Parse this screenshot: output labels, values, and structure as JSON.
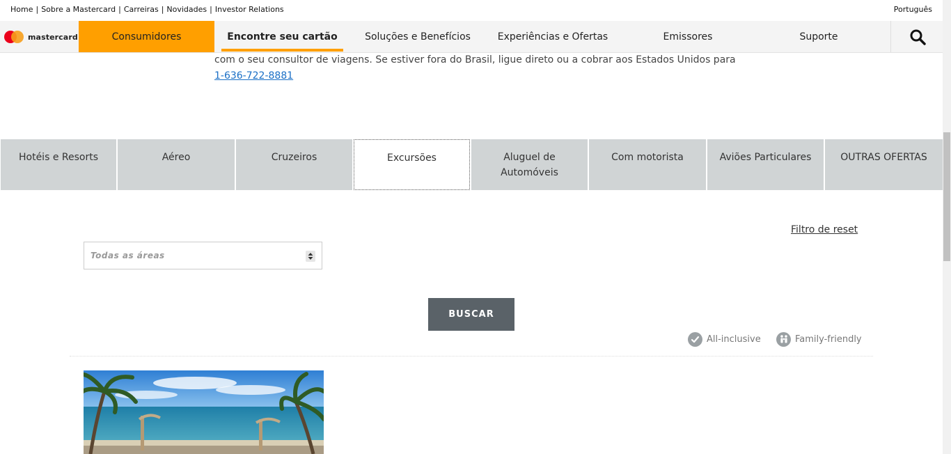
{
  "utility": {
    "links": [
      "Home",
      "Sobre a Mastercard",
      "Carreiras",
      "Novidades",
      "Investor Relations"
    ],
    "language": "Português"
  },
  "brand": {
    "name": "mastercard",
    "colors": {
      "red": "#eb001b",
      "orange": "#f79e1b",
      "accent": "#ff9f00"
    }
  },
  "nav": {
    "items": [
      "Consumidores",
      "Encontre seu cartão",
      "Soluções e Benefícios",
      "Experiências e Ofertas",
      "Emissores",
      "Suporte"
    ],
    "search_icon": "search-icon"
  },
  "intro": {
    "text": "com o seu consultor de viagens. Se estiver fora do Brasil, ligue direto ou a cobrar aos Estados Unidos para",
    "phone": "1-636-722-8881"
  },
  "tabs": [
    "Hotéis e Resorts",
    "Aéreo",
    "Cruzeiros",
    "Excursões",
    "Aluguel de Automóveis",
    "Com motorista",
    "Aviões Particulares",
    "OUTRAS OFERTAS"
  ],
  "filters": {
    "reset_label": "Filtro de reset",
    "area_select": "Todas as áreas",
    "search_button": "BUSCAR"
  },
  "legend": [
    "All-inclusive",
    "Family-friendly"
  ]
}
